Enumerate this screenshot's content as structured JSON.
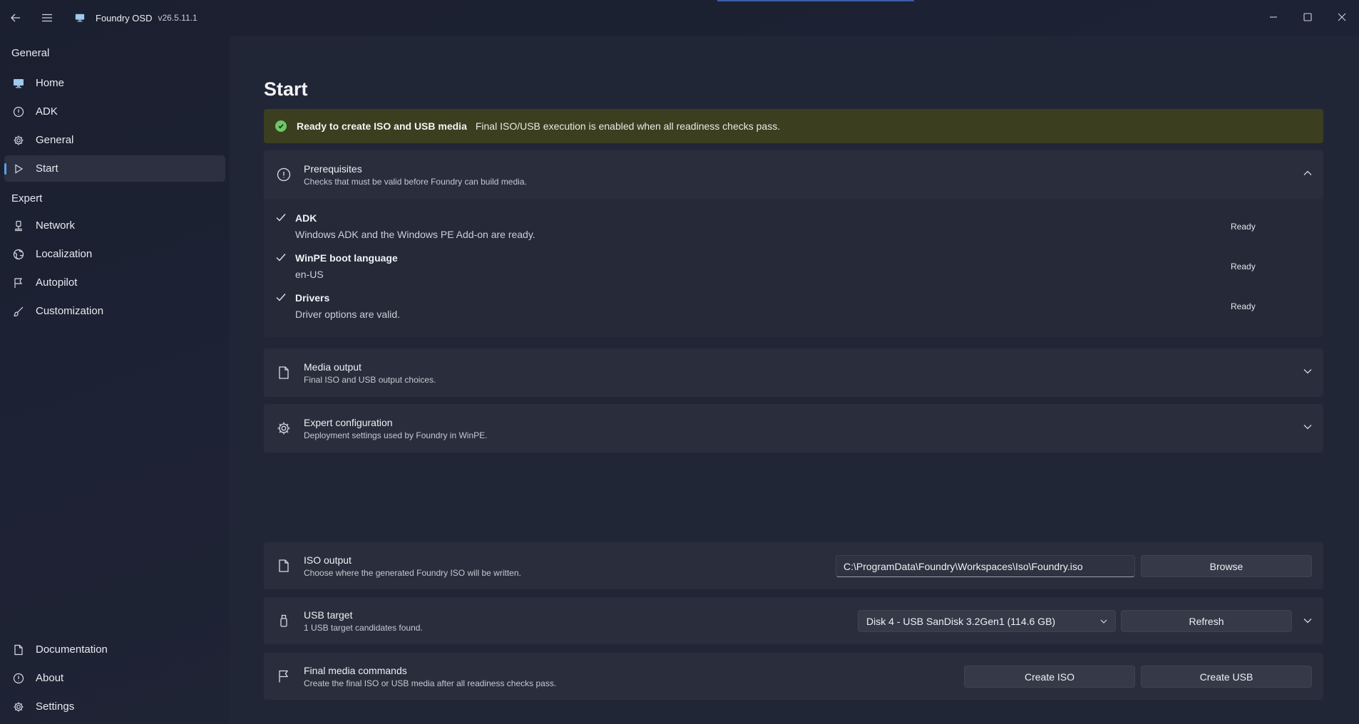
{
  "app": {
    "title": "Foundry OSD",
    "version": "v26.5.11.1"
  },
  "sidebar": {
    "sections": [
      {
        "label": "General",
        "items": [
          {
            "label": "Home",
            "icon": "monitor-icon"
          },
          {
            "label": "ADK",
            "icon": "info-icon"
          },
          {
            "label": "General",
            "icon": "gear-icon"
          },
          {
            "label": "Start",
            "icon": "play-icon",
            "active": true
          }
        ]
      },
      {
        "label": "Expert",
        "items": [
          {
            "label": "Network",
            "icon": "network-icon"
          },
          {
            "label": "Localization",
            "icon": "globe-icon"
          },
          {
            "label": "Autopilot",
            "icon": "flag-icon"
          },
          {
            "label": "Customization",
            "icon": "brush-icon"
          }
        ]
      }
    ],
    "bottom": [
      {
        "label": "Documentation",
        "icon": "document-icon"
      },
      {
        "label": "About",
        "icon": "info-icon"
      },
      {
        "label": "Settings",
        "icon": "gear-icon"
      }
    ]
  },
  "page": {
    "title": "Start",
    "banner": {
      "title": "Ready to create ISO and USB media",
      "message": "Final ISO/USB execution is enabled when all readiness checks pass.",
      "color": "#3b3f1f"
    },
    "prerequisites": {
      "title": "Prerequisites",
      "subtitle": "Checks that must be valid before Foundry can build media.",
      "checks": [
        {
          "name": "ADK",
          "description": "Windows ADK and the Windows PE Add-on are ready.",
          "status": "Ready"
        },
        {
          "name": "WinPE boot language",
          "description": "en-US",
          "status": "Ready"
        },
        {
          "name": "Drivers",
          "description": "Driver options are valid.",
          "status": "Ready"
        }
      ]
    },
    "media_output": {
      "title": "Media output",
      "subtitle": "Final ISO and USB output choices."
    },
    "expert_config": {
      "title": "Expert configuration",
      "subtitle": "Deployment settings used by Foundry in WinPE."
    },
    "iso_output": {
      "title": "ISO output",
      "subtitle": "Choose where the generated Foundry ISO will be written.",
      "path": "C:\\ProgramData\\Foundry\\Workspaces\\Iso\\Foundry.iso",
      "browse_label": "Browse"
    },
    "usb_target": {
      "title": "USB target",
      "subtitle": "1 USB target candidates found.",
      "selected": "Disk 4 - USB SanDisk 3.2Gen1 (114.6 GB)",
      "refresh_label": "Refresh"
    },
    "final_commands": {
      "title": "Final media commands",
      "subtitle": "Create the final ISO or USB media after all readiness checks pass.",
      "create_iso_label": "Create ISO",
      "create_usb_label": "Create USB"
    }
  }
}
